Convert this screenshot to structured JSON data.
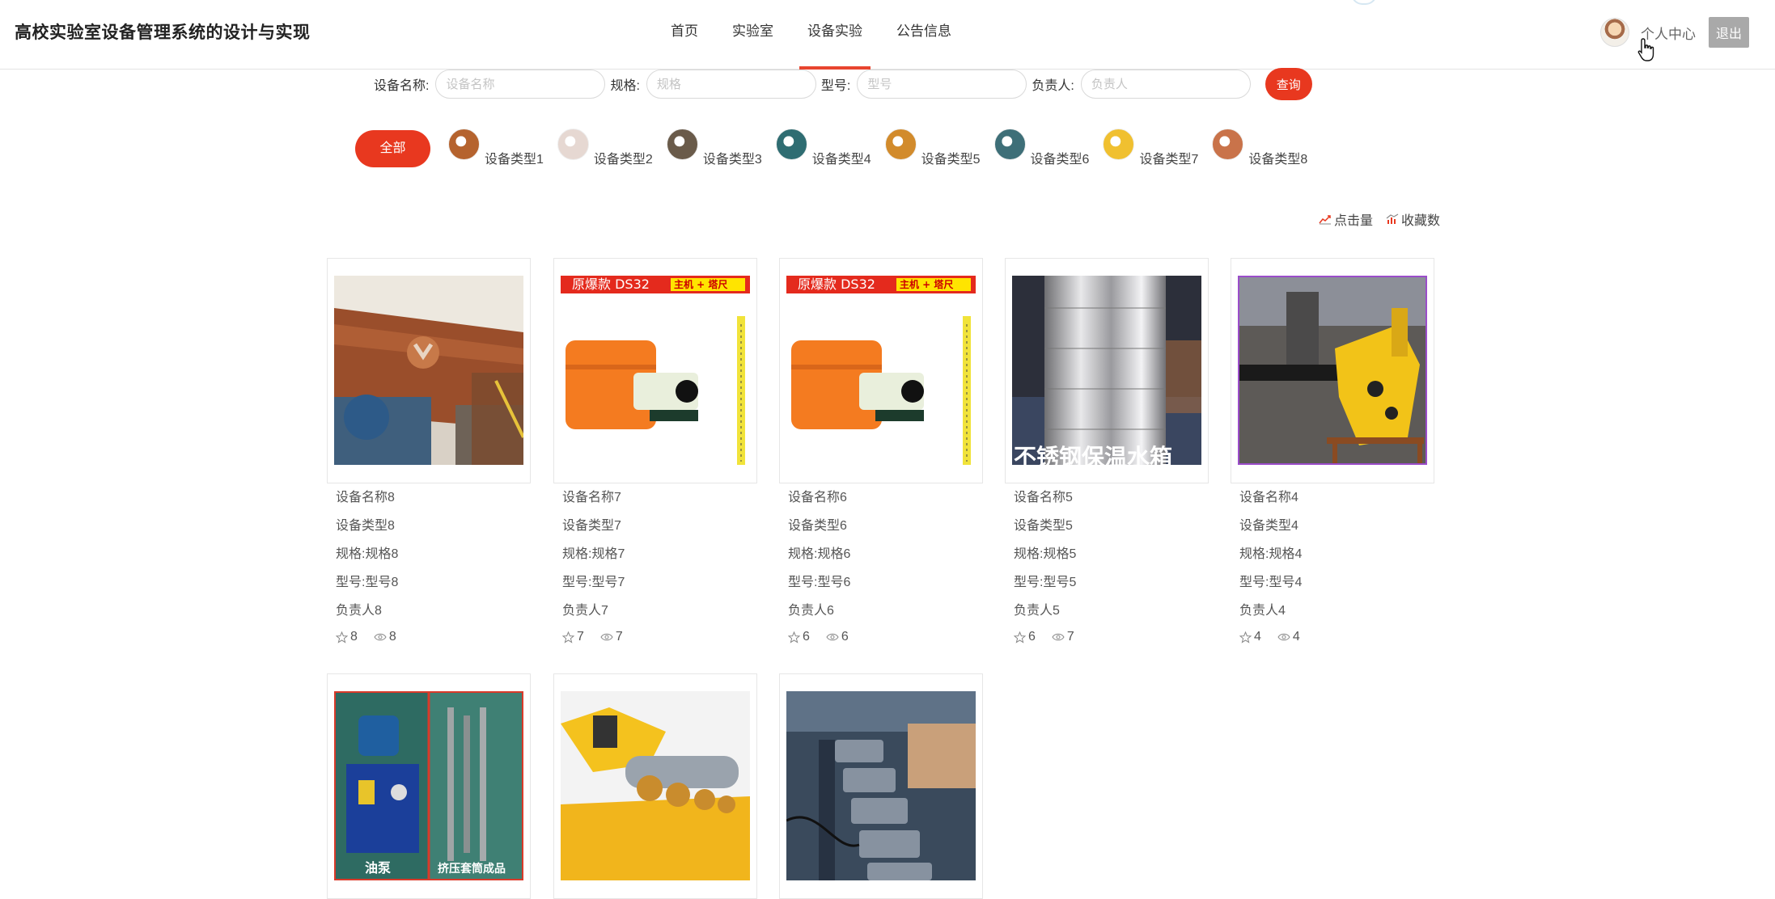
{
  "header": {
    "site_title": "高校实验室设备管理系统的设计与实现",
    "nav": [
      "首页",
      "实验室",
      "设备实验",
      "公告信息"
    ],
    "active_nav": 2,
    "user_center": "个人中心",
    "logout": "退出"
  },
  "search": {
    "fields": [
      {
        "label": "设备名称:",
        "placeholder": "设备名称"
      },
      {
        "label": "规格:",
        "placeholder": "规格"
      },
      {
        "label": "型号:",
        "placeholder": "型号"
      },
      {
        "label": "负责人:",
        "placeholder": "负责人"
      }
    ],
    "button": "查询"
  },
  "categories": {
    "all": "全部",
    "items": [
      "设备类型1",
      "设备类型2",
      "设备类型3",
      "设备类型4",
      "设备类型5",
      "设备类型6",
      "设备类型7",
      "设备类型8"
    ],
    "thumb_colors": [
      "#b5632e",
      "#e6d8d2",
      "#6a5b4a",
      "#2f6d72",
      "#d28b2c",
      "#3e6f78",
      "#f0c030",
      "#c9734a"
    ]
  },
  "sort": {
    "clicks": "点击量",
    "favorites": "收藏数"
  },
  "devices": [
    {
      "name": "设备名称8",
      "type": "设备类型8",
      "spec": "规格:规格8",
      "model": "型号:型号8",
      "owner": "负责人8",
      "stars": "8",
      "views": "8"
    },
    {
      "name": "设备名称7",
      "type": "设备类型7",
      "spec": "规格:规格7",
      "model": "型号:型号7",
      "owner": "负责人7",
      "stars": "7",
      "views": "7"
    },
    {
      "name": "设备名称6",
      "type": "设备类型6",
      "spec": "规格:规格6",
      "model": "型号:型号6",
      "owner": "负责人6",
      "stars": "6",
      "views": "6"
    },
    {
      "name": "设备名称5",
      "type": "设备类型5",
      "spec": "规格:规格5",
      "model": "型号:型号5",
      "owner": "负责人5",
      "stars": "6",
      "views": "7"
    },
    {
      "name": "设备名称4",
      "type": "设备类型4",
      "spec": "规格:规格4",
      "model": "型号:型号4",
      "owner": "负责人4",
      "stars": "4",
      "views": "4"
    }
  ],
  "image_texts": {
    "banner": "原爆款 DS32",
    "banner_tag": "主机 + 塔尺",
    "tank": "不锈钢保温水箱",
    "pump_left": "油泵",
    "pump_right": "挤压套筒成品"
  },
  "colors": {
    "accent": "#e8381f",
    "active_nav_underline": "#e8452f"
  }
}
